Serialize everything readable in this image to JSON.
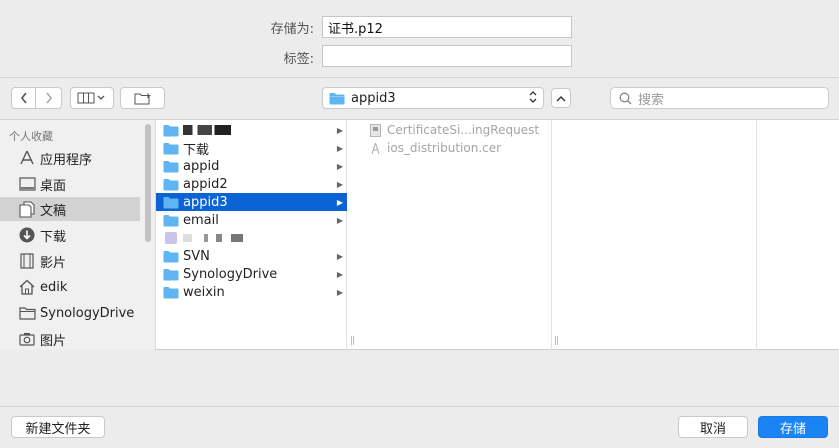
{
  "form": {
    "save_as_label": "存储为:",
    "save_as_value": "证书.p12",
    "tags_label": "标签:",
    "tags_value": ""
  },
  "toolbar": {
    "back_icon": "chevron-left",
    "forward_icon": "chevron-right",
    "view_icon": "column-view",
    "new_folder_icon": "new-folder",
    "location": "appid3",
    "search_placeholder": "搜索"
  },
  "sidebar": {
    "section_title": "个人收藏",
    "items": [
      {
        "label": "应用程序",
        "icon": "applications-icon"
      },
      {
        "label": "桌面",
        "icon": "desktop-icon"
      },
      {
        "label": "文稿",
        "icon": "documents-icon",
        "selected": true
      },
      {
        "label": "下载",
        "icon": "downloads-icon"
      },
      {
        "label": "影片",
        "icon": "movies-icon"
      },
      {
        "label": "edik",
        "icon": "home-icon"
      },
      {
        "label": "SynologyDrive",
        "icon": "folder-icon"
      },
      {
        "label": "图片",
        "icon": "camera-icon"
      }
    ]
  },
  "column1": {
    "items": [
      {
        "label": "",
        "redacted": true,
        "arrow": true
      },
      {
        "label": "下载",
        "arrow": true
      },
      {
        "label": "appid",
        "arrow": true
      },
      {
        "label": "appid2",
        "arrow": true
      },
      {
        "label": "appid3",
        "arrow": true,
        "selected": true
      },
      {
        "label": "email",
        "arrow": true
      },
      {
        "label": "",
        "redacted": true,
        "arrow": false
      },
      {
        "label": "SVN",
        "arrow": true
      },
      {
        "label": "SynologyDrive",
        "arrow": true
      },
      {
        "label": "weixin",
        "arrow": true
      }
    ]
  },
  "column2": {
    "items": [
      {
        "label": "CertificateSi...ingRequest",
        "icon": "certificate-request-icon"
      },
      {
        "label": "ios_distribution.cer",
        "icon": "certificate-icon"
      }
    ]
  },
  "bottom": {
    "new_folder_label": "新建文件夹",
    "cancel_label": "取消",
    "save_label": "存储"
  },
  "colors": {
    "accent": "#1b84f5",
    "selection": "#0b63d6",
    "folder": "#5fb4f2"
  }
}
